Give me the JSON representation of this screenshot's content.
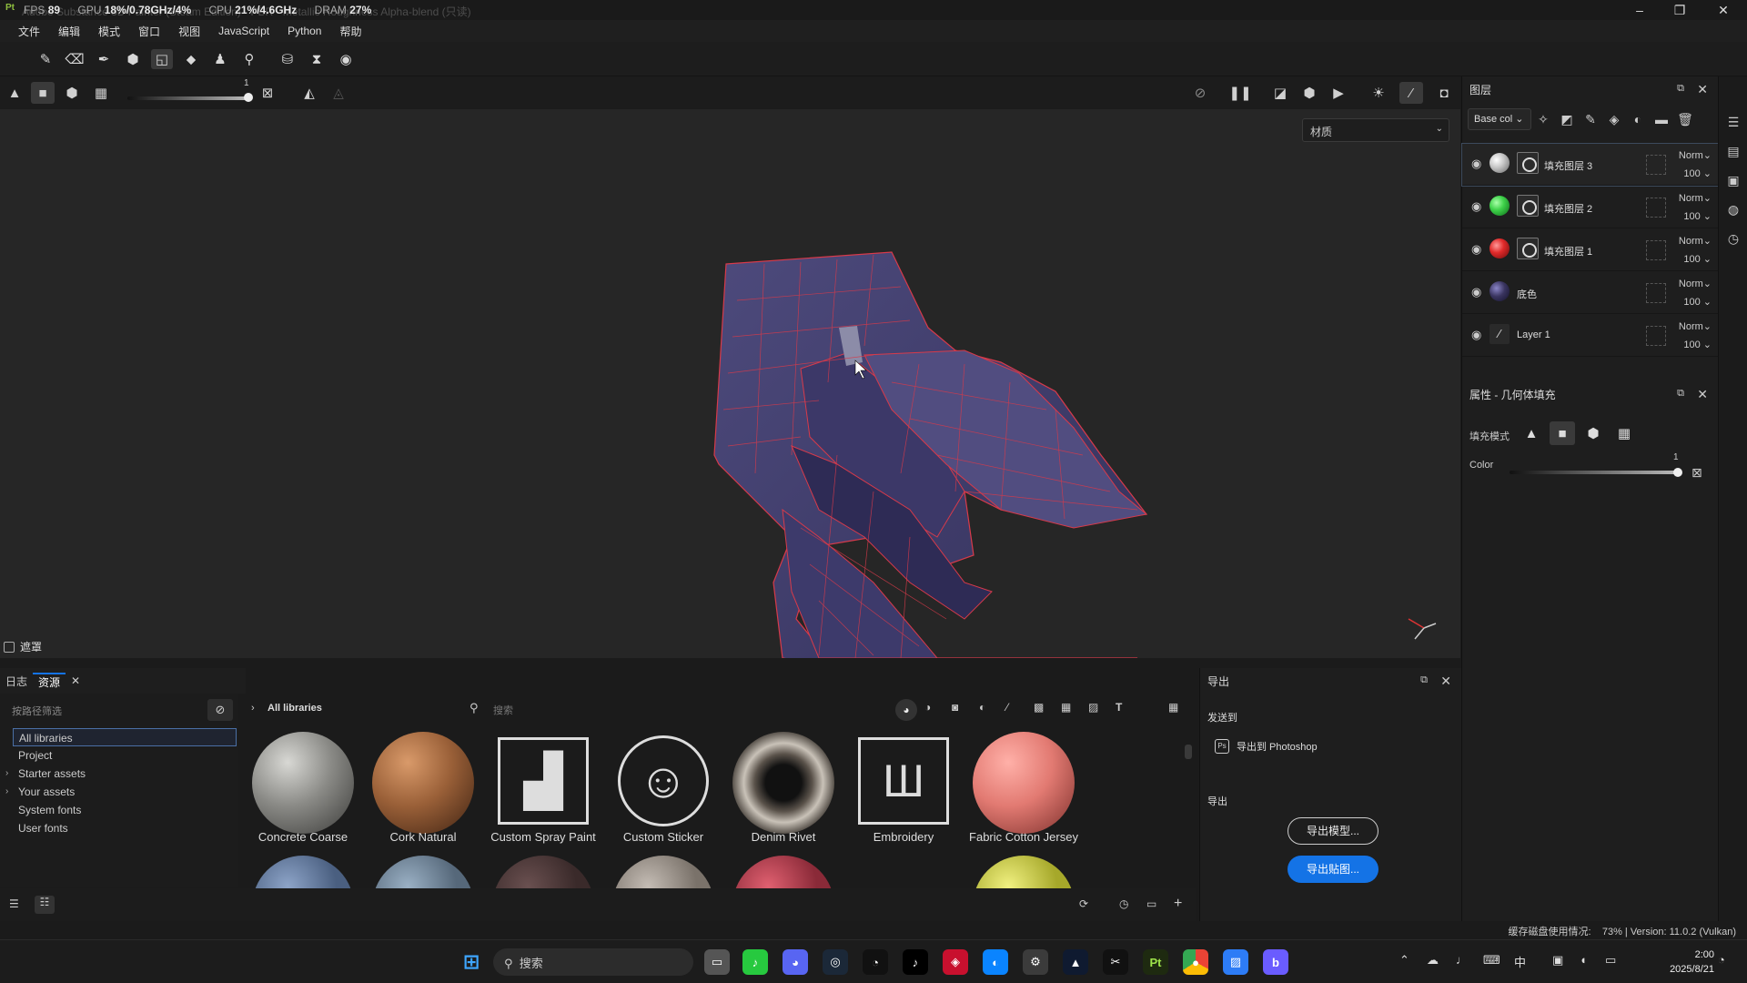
{
  "titlebar": {
    "doc_title": "Adobe Substance 3D Painter (Steam Edition) - PBR - Metallic Roughness Alpha-blend (只读)",
    "fps_label": "FPS",
    "fps": "89",
    "gpu_label": "GPU",
    "gpu": "18%/0.78GHz/4%",
    "cpu_label": "CPU",
    "cpu": "21%/4.6GHz",
    "dram_label": "DRAM",
    "dram": "27%"
  },
  "menu": [
    "文件",
    "编辑",
    "模式",
    "窗口",
    "视图",
    "JavaScript",
    "Python",
    "帮助"
  ],
  "toolbar2": {
    "slider_value": "1"
  },
  "viewport": {
    "material_select": "材质",
    "mask_label": "遮罩"
  },
  "layers_panel": {
    "title": "图层",
    "channel": "Base col",
    "layers": [
      {
        "name": "填充图层 3",
        "blend": "Norm",
        "opacity": "100",
        "color": "#c8c8c8"
      },
      {
        "name": "填充图层 2",
        "blend": "Norm",
        "opacity": "100",
        "color": "#3fd24a"
      },
      {
        "name": "填充图层 1",
        "blend": "Norm",
        "opacity": "100",
        "color": "#e02a2a"
      },
      {
        "name": "底色",
        "blend": "Norm",
        "opacity": "100",
        "color": "#3a3560"
      },
      {
        "name": "Layer 1",
        "blend": "Norm",
        "opacity": "100",
        "color": "#2a2a2a"
      }
    ]
  },
  "properties_panel": {
    "title": "属性 - 几何体填充",
    "fill_mode_label": "填充模式",
    "color_label": "Color",
    "slider_value": "1"
  },
  "bottom_tabs": {
    "log": "日志",
    "assets": "资源"
  },
  "library": {
    "filter_placeholder": "按路径筛选",
    "tree": [
      "All libraries",
      "Project",
      "Starter assets",
      "Your assets",
      "System fonts",
      "User fonts"
    ],
    "breadcrumb": "All libraries",
    "search_placeholder": "搜索",
    "assets": [
      {
        "name": "Concrete Coarse",
        "color": "#8a8a86"
      },
      {
        "name": "Cork Natural",
        "color": "#9a6038"
      },
      {
        "name": "Custom Spray Paint",
        "color": ""
      },
      {
        "name": "Custom Sticker",
        "color": ""
      },
      {
        "name": "Denim Rivet",
        "color": "#4a443e"
      },
      {
        "name": "Embroidery",
        "color": ""
      },
      {
        "name": "Fabric Cotton Jersey",
        "color": "#e27a72"
      }
    ]
  },
  "export_panel": {
    "title": "导出",
    "send_to": "发送到",
    "photoshop": "导出到 Photoshop",
    "export_section": "导出",
    "export_model": "导出模型...",
    "export_textures": "导出贴图..."
  },
  "statusbar": {
    "disk": "缓存磁盘使用情况:",
    "info": "73% | Version: 11.0.2 (Vulkan)"
  },
  "taskbar": {
    "search": "搜索",
    "time": "2:00",
    "date": "2025/8/21",
    "ime": "中"
  }
}
